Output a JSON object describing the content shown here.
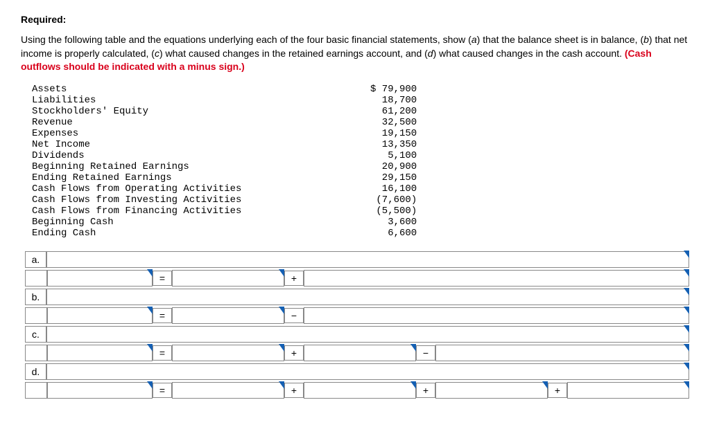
{
  "heading": "Required:",
  "instructions_parts": {
    "p1": "Using the following table and the equations underlying each of the four basic financial statements, show (",
    "a": "a",
    "p2": ") that the balance sheet is in balance, (",
    "b": "b",
    "p3": ") that net income is properly calculated, (",
    "c": "c",
    "p4": ") what caused changes in the retained earnings account, and (",
    "d": "d",
    "p5": ") what caused changes in the cash account. ",
    "red": "(Cash outflows should be indicated with a minus sign.)"
  },
  "data_rows": [
    {
      "label": "Assets",
      "value": "$ 79,900"
    },
    {
      "label": "Liabilities",
      "value": "18,700"
    },
    {
      "label": "Stockholders' Equity",
      "value": "61,200"
    },
    {
      "label": "Revenue",
      "value": "32,500"
    },
    {
      "label": "Expenses",
      "value": "19,150"
    },
    {
      "label": "Net Income",
      "value": "13,350"
    },
    {
      "label": "Dividends",
      "value": "5,100"
    },
    {
      "label": "Beginning Retained Earnings",
      "value": "20,900"
    },
    {
      "label": "Ending Retained Earnings",
      "value": "29,150"
    },
    {
      "label": "Cash Flows from Operating Activities",
      "value": "16,100"
    },
    {
      "label": "Cash Flows from Investing Activities",
      "value": "(7,600)"
    },
    {
      "label": "Cash Flows from Financing Activities",
      "value": "(5,500)"
    },
    {
      "label": "Beginning Cash",
      "value": "3,600"
    },
    {
      "label": "Ending Cash",
      "value": "6,600"
    }
  ],
  "labels": {
    "a": "a.",
    "b": "b.",
    "c": "c.",
    "d": "d."
  },
  "ops": {
    "eq": "=",
    "plus": "+",
    "minus": "−"
  }
}
